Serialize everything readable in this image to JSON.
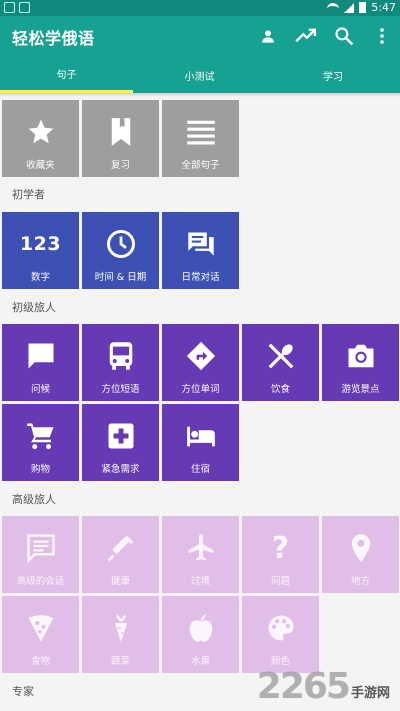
{
  "status_bar": {
    "time": "5:47"
  },
  "app_bar": {
    "title": "轻松学俄语",
    "actions": [
      "person-icon",
      "trending-up-icon",
      "search-icon",
      "more-vert-icon"
    ]
  },
  "tabs": [
    {
      "label": "句子",
      "active": true
    },
    {
      "label": "小测试",
      "active": false
    },
    {
      "label": "学习",
      "active": false
    }
  ],
  "top_tiles": [
    {
      "label": "收藏夹",
      "icon": "star-icon"
    },
    {
      "label": "复习",
      "icon": "bookmark-icon"
    },
    {
      "label": "全部句子",
      "icon": "list-icon"
    }
  ],
  "sections": [
    {
      "title": "初学者",
      "tiles": [
        {
          "label": "数字",
          "icon": "numbers-icon",
          "glyph": "123"
        },
        {
          "label": "时间 & 日期",
          "icon": "clock-icon"
        },
        {
          "label": "日常对话",
          "icon": "chat-bubbles-icon"
        }
      ]
    },
    {
      "title": "初级旅人",
      "tiles": [
        {
          "label": "问候",
          "icon": "chat-bubble-icon"
        },
        {
          "label": "方位短语",
          "icon": "bus-icon"
        },
        {
          "label": "方位单词",
          "icon": "directions-sign-icon"
        },
        {
          "label": "饮食",
          "icon": "utensils-icon"
        },
        {
          "label": "游览景点",
          "icon": "camera-icon"
        },
        {
          "label": "购物",
          "icon": "shopping-cart-icon"
        },
        {
          "label": "紧急需求",
          "icon": "medical-cross-icon"
        },
        {
          "label": "住宿",
          "icon": "bed-icon"
        }
      ]
    },
    {
      "title": "高级旅人",
      "tiles": [
        {
          "label": "高级的会话",
          "icon": "message-icon"
        },
        {
          "label": "健康",
          "icon": "syringe-icon"
        },
        {
          "label": "过境",
          "icon": "airplane-icon"
        },
        {
          "label": "问题",
          "icon": "question-mark-icon",
          "glyph": "?"
        },
        {
          "label": "地方",
          "icon": "location-pin-icon"
        },
        {
          "label": "食物",
          "icon": "pizza-icon"
        },
        {
          "label": "蔬菜",
          "icon": "carrot-icon"
        },
        {
          "label": "水果",
          "icon": "apple-icon"
        },
        {
          "label": "颜色",
          "icon": "palette-icon"
        }
      ]
    },
    {
      "title": "专家",
      "tiles": []
    }
  ],
  "watermark": {
    "number": "2265",
    "text": "手游网"
  },
  "colors": {
    "app_bar": "#16a192",
    "status_bar": "#0f8a7d",
    "tab_indicator": "#fff35a",
    "grey_tile": "#9e9e9e",
    "blue_tile": "#3d51b5",
    "purple_tile": "#663ab5",
    "light_tile": "#e1bee7"
  }
}
